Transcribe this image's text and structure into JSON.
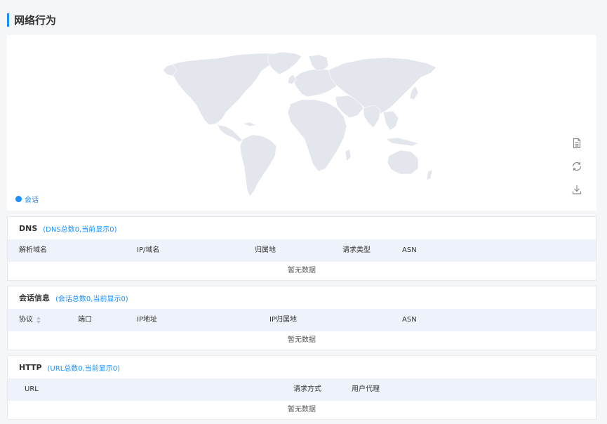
{
  "page": {
    "title": "网络行为"
  },
  "map": {
    "legend_label": "会话",
    "legend_color": "#1890ff",
    "land_color": "#e3e6ec",
    "toolbox": [
      {
        "name": "data-view",
        "icon": "document-icon"
      },
      {
        "name": "restore",
        "icon": "refresh-icon"
      },
      {
        "name": "save-image",
        "icon": "download-icon"
      }
    ]
  },
  "dns": {
    "title": "DNS",
    "summary": "(DNS总数0,当前显示0)",
    "columns": [
      "解析域名",
      "IP/域名",
      "归属地",
      "请求类型",
      "ASN"
    ],
    "empty_text": "暂无数据"
  },
  "sessions": {
    "title": "会话信息",
    "summary": "(会话总数0,当前显示0)",
    "columns": [
      "协议",
      "端口",
      "IP地址",
      "IP归属地",
      "ASN"
    ],
    "empty_text": "暂无数据"
  },
  "http": {
    "title": "HTTP",
    "summary": "(URL总数0,当前显示0)",
    "columns": [
      "URL",
      "请求方式",
      "用户代理"
    ],
    "empty_text": "暂无数据"
  },
  "colors": {
    "accent": "#1890ff",
    "header_bg": "#eef2fa",
    "page_bg": "#f5f6f8"
  }
}
